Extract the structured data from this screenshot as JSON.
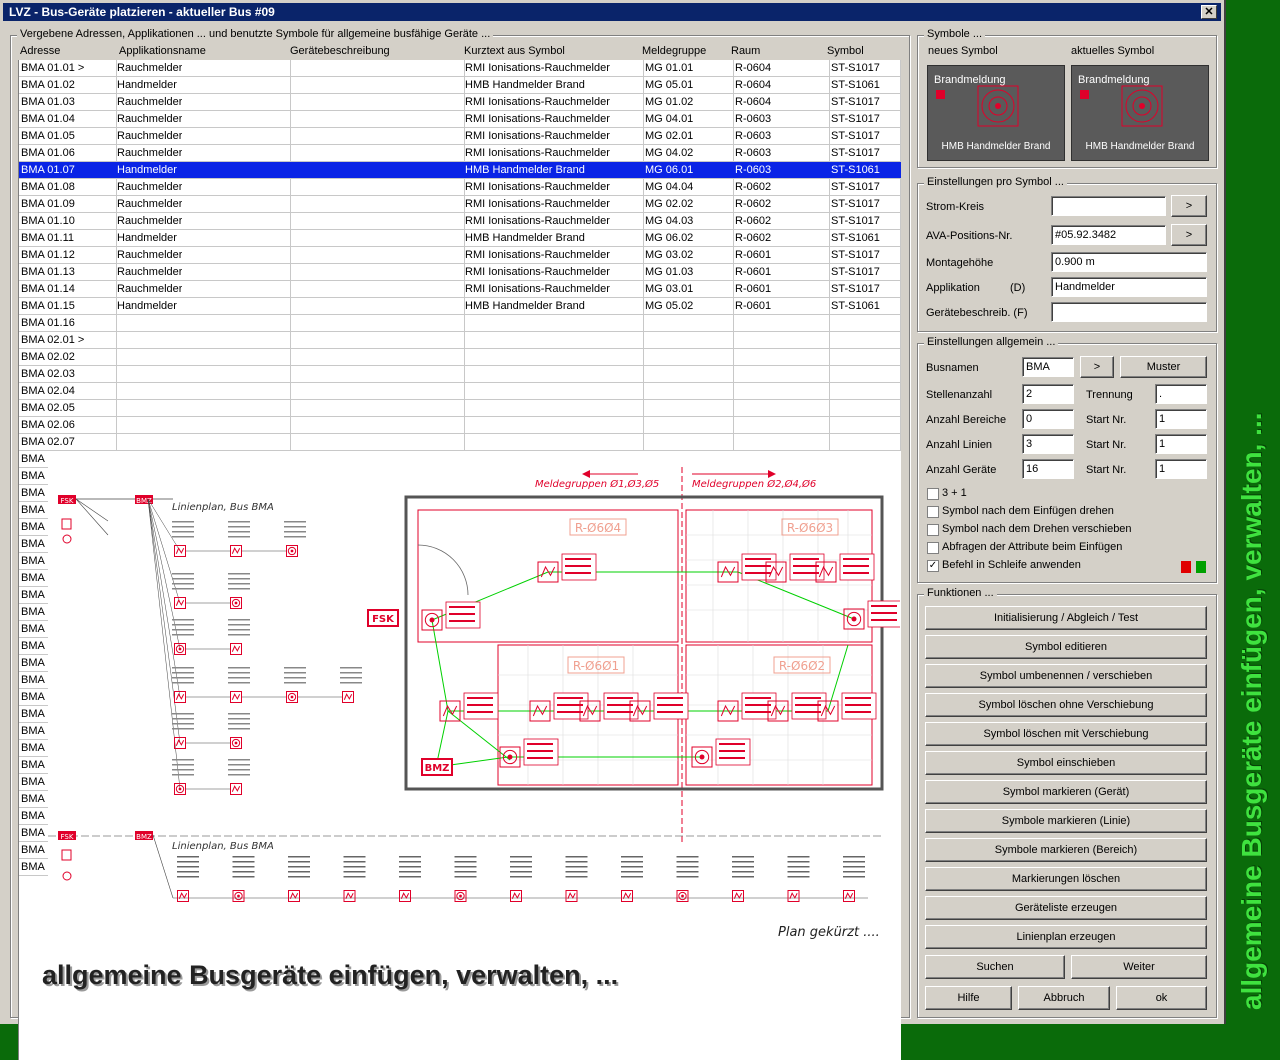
{
  "window": {
    "title": "LVZ - Bus-Geräte platzieren - aktueller Bus #09",
    "close_glyph": "✕"
  },
  "left_group": {
    "caption": "Vergebene Adressen, Applikationen ... und benutzte Symbole für allgemeine busfähige Geräte ..."
  },
  "table": {
    "headers": [
      "Adresse",
      "Applikationsname",
      "Gerätebeschreibung",
      "Kurztext aus Symbol",
      "Meldegruppe",
      "Raum",
      "Symbol"
    ],
    "selected_index": 6,
    "rows": [
      [
        "BMA 01.01 >",
        "Rauchmelder",
        "",
        "RMI Ionisations-Rauchmelder",
        "MG 01.01",
        "R-0604",
        "ST-S1017"
      ],
      [
        "BMA 01.02",
        "Handmelder",
        "",
        "HMB Handmelder Brand",
        "MG 05.01",
        "R-0604",
        "ST-S1061"
      ],
      [
        "BMA 01.03",
        "Rauchmelder",
        "",
        "RMI Ionisations-Rauchmelder",
        "MG 01.02",
        "R-0604",
        "ST-S1017"
      ],
      [
        "BMA 01.04",
        "Rauchmelder",
        "",
        "RMI Ionisations-Rauchmelder",
        "MG 04.01",
        "R-0603",
        "ST-S1017"
      ],
      [
        "BMA 01.05",
        "Rauchmelder",
        "",
        "RMI Ionisations-Rauchmelder",
        "MG 02.01",
        "R-0603",
        "ST-S1017"
      ],
      [
        "BMA 01.06",
        "Rauchmelder",
        "",
        "RMI Ionisations-Rauchmelder",
        "MG 04.02",
        "R-0603",
        "ST-S1017"
      ],
      [
        "BMA 01.07",
        "Handmelder",
        "",
        "HMB Handmelder Brand",
        "MG 06.01",
        "R-0603",
        "ST-S1061"
      ],
      [
        "BMA 01.08",
        "Rauchmelder",
        "",
        "RMI Ionisations-Rauchmelder",
        "MG 04.04",
        "R-0602",
        "ST-S1017"
      ],
      [
        "BMA 01.09",
        "Rauchmelder",
        "",
        "RMI Ionisations-Rauchmelder",
        "MG 02.02",
        "R-0602",
        "ST-S1017"
      ],
      [
        "BMA 01.10",
        "Rauchmelder",
        "",
        "RMI Ionisations-Rauchmelder",
        "MG 04.03",
        "R-0602",
        "ST-S1017"
      ],
      [
        "BMA 01.11",
        "Handmelder",
        "",
        "HMB Handmelder Brand",
        "MG 06.02",
        "R-0602",
        "ST-S1061"
      ],
      [
        "BMA 01.12",
        "Rauchmelder",
        "",
        "RMI Ionisations-Rauchmelder",
        "MG 03.02",
        "R-0601",
        "ST-S1017"
      ],
      [
        "BMA 01.13",
        "Rauchmelder",
        "",
        "RMI Ionisations-Rauchmelder",
        "MG 01.03",
        "R-0601",
        "ST-S1017"
      ],
      [
        "BMA 01.14",
        "Rauchmelder",
        "",
        "RMI Ionisations-Rauchmelder",
        "MG 03.01",
        "R-0601",
        "ST-S1017"
      ],
      [
        "BMA 01.15",
        "Handmelder",
        "",
        "HMB Handmelder Brand",
        "MG 05.02",
        "R-0601",
        "ST-S1061"
      ],
      [
        "BMA 01.16",
        "",
        "",
        "",
        "",
        "",
        ""
      ],
      [
        "BMA 02.01 >",
        "",
        "",
        "",
        "",
        "",
        ""
      ],
      [
        "BMA 02.02",
        "",
        "",
        "",
        "",
        "",
        ""
      ],
      [
        "BMA 02.03",
        "",
        "",
        "",
        "",
        "",
        ""
      ],
      [
        "BMA 02.04",
        "",
        "",
        "",
        "",
        "",
        ""
      ],
      [
        "BMA 02.05",
        "",
        "",
        "",
        "",
        "",
        ""
      ],
      [
        "BMA 02.06",
        "",
        "",
        "",
        "",
        "",
        ""
      ],
      [
        "BMA 02.07",
        "",
        "",
        "",
        "",
        "",
        ""
      ]
    ],
    "cut_rows": [
      "BMA",
      "BMA",
      "BMA",
      "BMA",
      "BMA",
      "BMA",
      "BMA",
      "BMA",
      "BMA",
      "BMA",
      "BMA",
      "BMA",
      "BMA",
      "BMA",
      "BMA",
      "BMA",
      "BMA",
      "BMA",
      "BMA",
      "BMA",
      "BMA",
      "BMA",
      "BMA",
      "BMA",
      "BMA"
    ]
  },
  "drawing": {
    "meldegruppen_left": "Meldegruppen Ø1,Ø3,Ø5",
    "meldegruppen_right": "Meldegruppen Ø2,Ø4,Ø6",
    "linienplan_1": "Linienplan, Bus BMA",
    "linienplan_2": "Linienplan, Bus BMA",
    "room_labels": [
      "R-Ø6Ø4",
      "R-Ø6Ø3",
      "R-Ø6Ø1",
      "R-Ø6Ø2"
    ],
    "fsk": "FSK",
    "bmz": "BMZ",
    "plan_note": "Plan gekürzt ....",
    "device_codes": [
      "D",
      "D",
      "ZD",
      "ZD",
      "D",
      "ZD",
      "D",
      "ZD",
      "ZD",
      "D",
      "ZD"
    ]
  },
  "overlay_caption": "allgemeine Busgeräte einfügen, verwalten, ...",
  "side_caption": "allgemeine Busgeräte einfügen, verwalten, ...",
  "symbols": {
    "caption": "Symbole ...",
    "new_label": "neues Symbol",
    "current_label": "aktuelles Symbol",
    "new_title": "Brandmeldung",
    "new_sub": "HMB  Handmelder  Brand",
    "current_title": "Brandmeldung",
    "current_sub": "HMB  Handmelder  Brand"
  },
  "per_symbol": {
    "caption": "Einstellungen pro Symbol ...",
    "strom_label": "Strom-Kreis",
    "strom_value": "",
    "ava_label": "AVA-Positions-Nr.",
    "ava_value": "#05.92.3482",
    "montage_label": "Montagehöhe",
    "montage_value": "0.900 m",
    "appl_label": "Applikation",
    "appl_key": "(D)",
    "appl_value": "Handmelder",
    "geraet_label": "Gerätebeschreib. (F)",
    "geraet_value": "",
    "arrow_btn": ">"
  },
  "general": {
    "caption": "Einstellungen allgemein ...",
    "busnamen_label": "Busnamen",
    "busnamen_value": "BMA",
    "arrow_btn": ">",
    "muster_btn": "Muster",
    "stellen_label": "Stellenanzahl",
    "stellen_value": "2",
    "trennung_label": "Trennung",
    "trennung_value": ".",
    "bereiche_label": "Anzahl Bereiche",
    "bereiche_value": "0",
    "linien_label": "Anzahl Linien",
    "linien_value": "3",
    "geraete_label": "Anzahl Geräte",
    "geraete_value": "16",
    "start_label": "Start Nr.",
    "start_bereiche": "1",
    "start_linien": "1",
    "start_geraete": "1",
    "checkboxes": [
      {
        "label": "3 + 1",
        "checked": false
      },
      {
        "label": "Symbol nach dem Einfügen drehen",
        "checked": false
      },
      {
        "label": "Symbol nach dem Drehen verschieben",
        "checked": false
      },
      {
        "label": "Abfragen der Attribute beim Einfügen",
        "checked": false
      },
      {
        "label": "Befehl in Schleife anwenden",
        "checked": true
      }
    ],
    "check_glyph": "✓"
  },
  "functions": {
    "caption": "Funktionen ...",
    "buttons": [
      "Initialisierung / Abgleich / Test",
      "Symbol editieren",
      "Symbol umbenennen / verschieben",
      "Symbol löschen ohne Verschiebung",
      "Symbol löschen mit Verschiebung",
      "Symbol einschieben",
      "Symbol markieren (Gerät)",
      "Symbole markieren (Linie)",
      "Symbole markieren (Bereich)",
      "Markierungen löschen",
      "Geräteliste erzeugen",
      "Linienplan erzeugen"
    ],
    "suchen": "Suchen",
    "weiter": "Weiter",
    "hilfe": "Hilfe",
    "abbruch": "Abbruch",
    "ok": "ok"
  },
  "colors": {
    "accent_green": "#3fe23f",
    "selection": "#0a24e6",
    "cad_red": "#e0002a",
    "cad_green": "#00d000"
  }
}
